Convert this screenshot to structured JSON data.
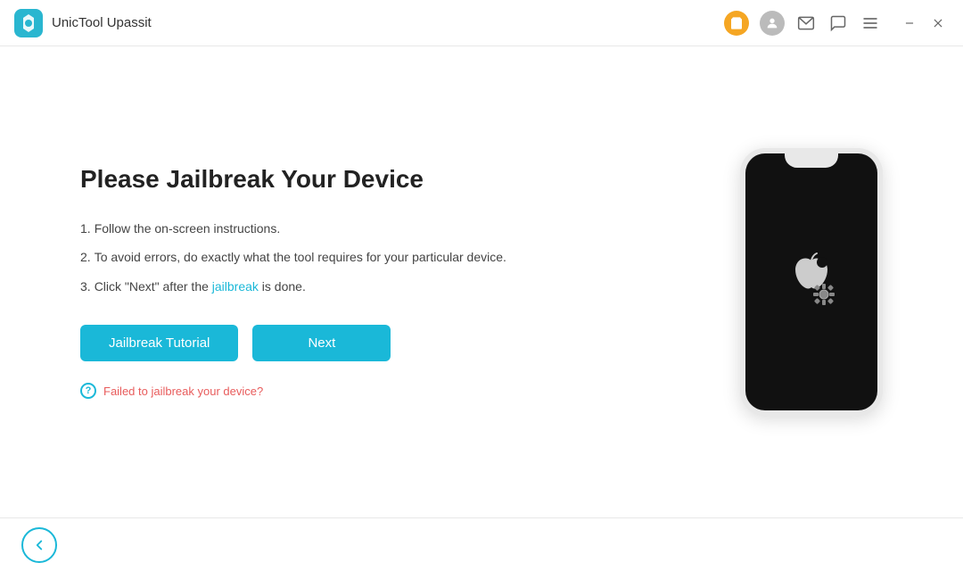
{
  "titleBar": {
    "appTitle": "UnicTool Upassit",
    "cartIcon": "🛒",
    "userIcon": "👤",
    "mailIcon": "✉",
    "chatIcon": "💬",
    "menuIcon": "≡",
    "minimizeIcon": "—",
    "closeIcon": "✕"
  },
  "main": {
    "pageTitle": "Please Jailbreak Your Device",
    "instructions": [
      {
        "num": "1.",
        "text": "Follow the on-screen instructions."
      },
      {
        "num": "2.",
        "text": "To avoid errors, do exactly what the tool requires for your particular device."
      },
      {
        "num": "3.",
        "text": "Click \"Next\" after the ",
        "highlight": "jailbreak",
        "textAfter": " is done."
      }
    ],
    "buttons": {
      "jailbreakTutorial": "Jailbreak Tutorial",
      "next": "Next"
    },
    "failedLink": "Failed to jailbreak your device?"
  },
  "bottomBar": {
    "backLabel": "←"
  }
}
